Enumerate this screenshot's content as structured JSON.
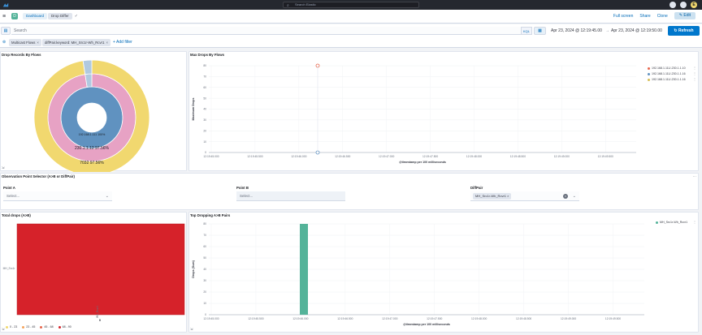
{
  "topbar": {
    "search_placeholder": "Search Elastic",
    "avatar_initial": "E"
  },
  "navbar": {
    "space_initial": "D",
    "breadcrumbs": [
      "Dashboard",
      "Drop Differ"
    ],
    "actions": {
      "full_screen": "Full screen",
      "share": "Share",
      "clone": "Clone",
      "edit": "Edit"
    }
  },
  "query": {
    "placeholder": "Search",
    "language": "KQL",
    "date_start": "Apr 23, 2024 @ 12:19:45.00",
    "arrow": "→",
    "date_end": "Apr 23, 2024 @ 12:19:50.00",
    "refresh": "Refresh"
  },
  "filters": {
    "pills": [
      "Multicast Flows",
      "diffPair.keyword: MH_Src1r-Wh_Rcvr1"
    ],
    "add_filter": "+ Add filter"
  },
  "panels": {
    "drop_records": {
      "title": "Drop Records By Flows",
      "labels": {
        "inner": "192.168.1.111",
        "inner_pct": "100%",
        "middle": "230.1.1.12",
        "middle_pct": "97.56%",
        "outer": "7032",
        "outer_pct": "97.56%"
      }
    },
    "max_drops": {
      "title": "Max Drops By Flows",
      "ylabel": "Maximum Drops",
      "xlabel": "@timestamp per 100 milliseconds",
      "yticks": [
        "80",
        "70",
        "60",
        "50",
        "40",
        "30",
        "20",
        "10",
        "0"
      ],
      "xticks": [
        "12:19:45.000",
        "12:19:45.500",
        "12:19:46.000",
        "12:19:46.500",
        "12:19:47.000",
        "12:19:47.500",
        "12:19:48.000",
        "12:19:48.500",
        "12:19:49.000",
        "12:19:49.500"
      ],
      "legend": [
        {
          "label": "192.168.1.111/-230.1.1.10",
          "color": "#e7664c"
        },
        {
          "label": "192.168.1.111/-230.1.1.16",
          "color": "#6092c0"
        },
        {
          "label": "192.168.1.111/-230.1.1.16",
          "color": "#d6bf57"
        }
      ]
    },
    "selector": {
      "title": "Observation Point Selector (A>B or DiffPair)",
      "point_a": {
        "label": "Point A",
        "placeholder": "Select..."
      },
      "point_b": {
        "label": "Point B",
        "placeholder": "Select..."
      },
      "diff_pair": {
        "label": "DiffPair",
        "value": "MH_Src1r-Wh_Rcvr1"
      }
    },
    "total_drops": {
      "title": "Total drops (A>B)",
      "row_label": "MH_Src1r",
      "col_label": "Wh_Rcvr1",
      "col_value": "0",
      "legend": [
        {
          "label": "0 - 23",
          "color": "#f1d86f"
        },
        {
          "label": "23 - 45",
          "color": "#f5a35c"
        },
        {
          "label": "45 - 68",
          "color": "#e7664c"
        },
        {
          "label": "68 - 90",
          "color": "#d6222a"
        }
      ]
    },
    "top_dropping": {
      "title": "Top Dropping A>B Pairs",
      "ylabel": "Drops (Sum)",
      "xlabel": "@timestamp per 100 milliseconds",
      "yticks": [
        "80",
        "70",
        "60",
        "50",
        "40",
        "30",
        "20",
        "10",
        "0"
      ],
      "xticks": [
        "12:19:45.000",
        "12:19:45.500",
        "12:19:46.000",
        "12:19:46.500",
        "12:19:47.000",
        "12:19:47.500",
        "12:19:48.000",
        "12:19:48.500",
        "12:19:49.000",
        "12:19:49.500"
      ],
      "legend": [
        {
          "label": "MH_Src1r-Wh_Rcvr1",
          "color": "#54b399"
        }
      ]
    }
  },
  "chart_data": [
    {
      "type": "pie",
      "title": "Drop Records By Flows",
      "rings": [
        {
          "level": "inner",
          "labels": [
            "192.168.1.111"
          ],
          "values": [
            100
          ]
        },
        {
          "level": "middle",
          "labels": [
            "230.1.1.12",
            "other"
          ],
          "values": [
            97.56,
            2.44
          ]
        },
        {
          "level": "outer",
          "labels": [
            "7032",
            "other"
          ],
          "values": [
            97.56,
            2.44
          ]
        }
      ]
    },
    {
      "type": "scatter",
      "title": "Max Drops By Flows",
      "xlabel": "@timestamp per 100 milliseconds",
      "ylabel": "Maximum Drops",
      "ylim": [
        0,
        80
      ],
      "series": [
        {
          "name": "192.168.1.111/-230.1.1.10",
          "x": [
            "12:19:45.000"
          ],
          "y": [
            80
          ]
        },
        {
          "name": "192.168.1.111/-230.1.1.16",
          "x": [
            "12:19:45.000"
          ],
          "y": [
            0
          ]
        }
      ]
    },
    {
      "type": "heatmap",
      "title": "Total drops (A>B)",
      "rows": [
        "MH_Src1r"
      ],
      "cols": [
        "Wh_Rcvr1"
      ],
      "values": [
        [
          90
        ]
      ]
    },
    {
      "type": "bar",
      "title": "Top Dropping A>B Pairs",
      "xlabel": "@timestamp per 100 milliseconds",
      "ylabel": "Drops (Sum)",
      "ylim": [
        0,
        80
      ],
      "series": [
        {
          "name": "MH_Src1r-Wh_Rcvr1",
          "categories": [
            "12:19:45.000"
          ],
          "values": [
            80
          ]
        }
      ]
    }
  ]
}
